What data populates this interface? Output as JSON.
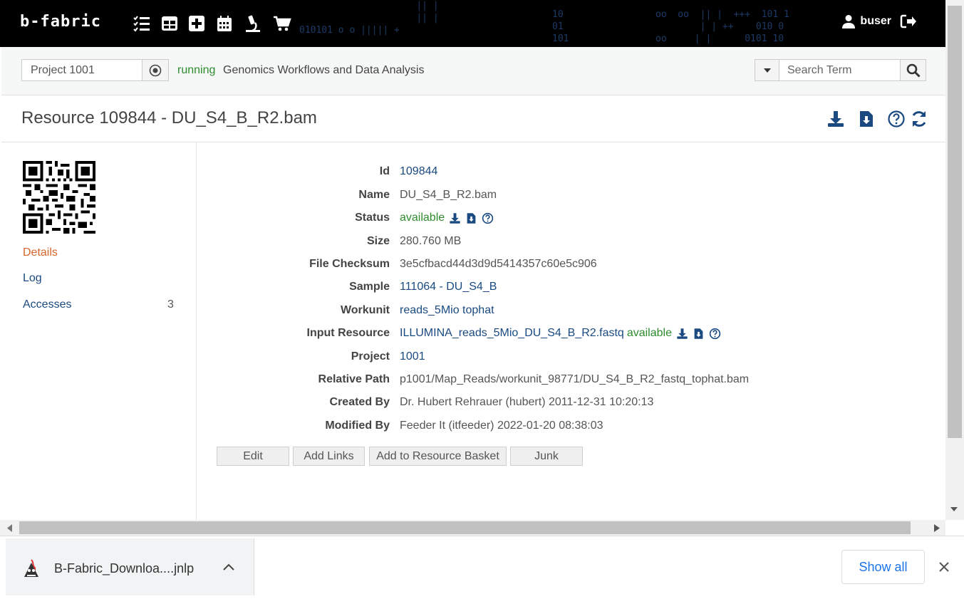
{
  "topbar": {
    "logo": "b-fabric",
    "matrix": [
      "10",
      "01",
      "101",
      "010101",
      "101 1",
      "010 0",
      "0101 10",
      "+++",
      "++",
      "oo",
      "||"
    ],
    "user": "buser",
    "icons": [
      "checklist-icon",
      "table-icon",
      "plus-square-icon",
      "calendar-icon",
      "microscope-icon",
      "cart-icon"
    ]
  },
  "project": {
    "input_value": "Project 1001",
    "status": "running",
    "name": "Genomics Workflows and Data Analysis"
  },
  "search": {
    "placeholder": "Search Term"
  },
  "page": {
    "title": "Resource 109844 - DU_S4_B_R2.bam"
  },
  "sidebar": {
    "items": [
      {
        "label": "Details"
      },
      {
        "label": "Log"
      },
      {
        "label": "Accesses",
        "count": "3"
      }
    ]
  },
  "details": {
    "id": {
      "label": "Id",
      "value": "109844"
    },
    "name": {
      "label": "Name",
      "value": "DU_S4_B_R2.bam"
    },
    "status": {
      "label": "Status",
      "value": "available"
    },
    "size": {
      "label": "Size",
      "value": "280.760 MB"
    },
    "checksum": {
      "label": "File Checksum",
      "value": "3e5cfbacd44d3d9d5414357c60e5c906"
    },
    "sample": {
      "label": "Sample",
      "value": "111064 - DU_S4_B"
    },
    "workunit": {
      "label": "Workunit",
      "value": "reads_5Mio tophat"
    },
    "input_resource": {
      "label": "Input Resource",
      "value": "ILLUMINA_reads_5Mio_DU_S4_B_R2.fastq",
      "status": "available"
    },
    "project": {
      "label": "Project",
      "value": "1001"
    },
    "relative_path": {
      "label": "Relative Path",
      "value": "p1001/Map_Reads/workunit_98771/DU_S4_B_R2_fastq_tophat.bam"
    },
    "created_by": {
      "label": "Created By",
      "value": "Dr. Hubert Rehrauer (hubert) 2011-12-31 10:20:13"
    },
    "modified_by": {
      "label": "Modified By",
      "value": "Feeder It (itfeeder) 2022-01-20 08:38:03"
    }
  },
  "actions": {
    "edit": "Edit",
    "add_links": "Add Links",
    "add_basket": "Add to Resource Basket",
    "junk": "Junk"
  },
  "download_bar": {
    "file": "B-Fabric_Downloa....jnlp",
    "show_all": "Show all"
  },
  "colors": {
    "link": "#1a4a80",
    "green": "#2e8b2e",
    "accent_orange": "#d9652b",
    "topbar": "#000000"
  }
}
